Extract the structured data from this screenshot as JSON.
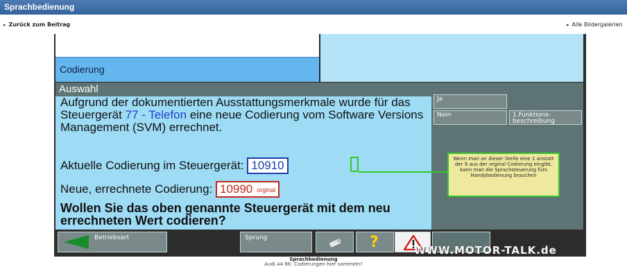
{
  "window": {
    "title": "Sprachbedienung"
  },
  "nav": {
    "back_label": "Zurück zum Beitrag",
    "gallery_label": "Alle Bildergalerien"
  },
  "screen": {
    "tab_label": "Codierung",
    "section_label": "Auswahl",
    "description_pre": "Aufgrund der dokumentierten Ausstattungsmerkmale wurde für das Steuergerät ",
    "description_highlight": "77 - Telefon",
    "description_post": " eine neue Codierung vom Software Versions Management (SVM) errechnet.",
    "current_label": "Aktuelle Codierung im Steuergerät:",
    "current_value_a": "109",
    "current_value_b": "1",
    "current_value_c": "0",
    "new_label": "Neue, errechnete Codierung:",
    "new_value": "10990",
    "new_value_note": "orginal",
    "question": "Wollen Sie das oben genannte Steuergerät mit dem neu errechneten Wert codieren?"
  },
  "side_buttons": {
    "yes": "Ja",
    "no": "Nein",
    "func": "1.Funktions-beschreibung"
  },
  "annotation": {
    "text": "Wenn man an dieser Stelle eine 1 anstatt der 9 aus der orginal Codierung eingibt, kann man die Sprachsteuerung fürs Handybedienung brauchen"
  },
  "bottom_buttons": {
    "operating_mode": "Betriebsart",
    "jump": "Sprung",
    "help_glyph": "?"
  },
  "watermark": "WWW.MOTOR-TALK.de",
  "footer": {
    "title": "Sprachbedienung",
    "subtitle": "Audi A4 8K: Codierungen hier sammeln?"
  },
  "colors": {
    "accent_green": "#35c82a",
    "value_blue": "#1c3da8",
    "value_red": "#c2281c",
    "panel_cyan": "#9edcf5"
  }
}
